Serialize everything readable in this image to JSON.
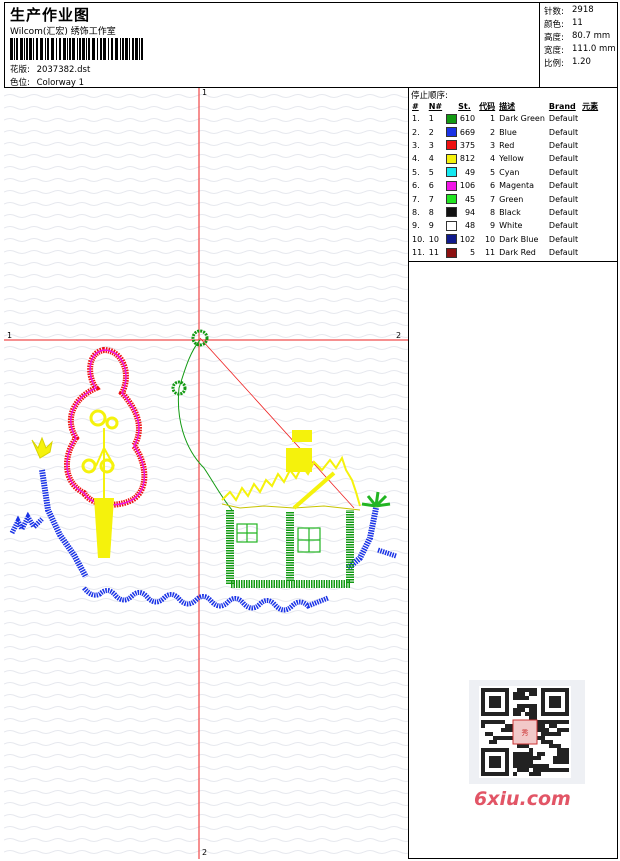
{
  "header": {
    "title": "生产作业图",
    "subtitle": "Wilcom(汇宏) 绣饰工作室",
    "design_label": "花版:",
    "design_value": "2037382.dst",
    "colorway_label": "色位:",
    "colorway_value": "Colorway 1"
  },
  "stats": [
    {
      "label": "针数:",
      "value": "2918"
    },
    {
      "label": "颜色:",
      "value": "11"
    },
    {
      "label": "高度:",
      "value": "80.7 mm"
    },
    {
      "label": "宽度:",
      "value": "111.0 mm"
    },
    {
      "label": "比例:",
      "value": "1.20"
    }
  ],
  "axes": {
    "top": "1",
    "bottom": "2",
    "left": "1",
    "right": "2"
  },
  "sequence": {
    "title": "停止顺序:",
    "columns": [
      "#",
      "N#",
      "St.",
      "代码",
      "描述",
      "Brand",
      "元素"
    ],
    "rows": [
      {
        "idx": "1.",
        "n": "1",
        "color": "#129a12",
        "st": "610",
        "code": "1",
        "desc": "Dark Green",
        "brand": "Default"
      },
      {
        "idx": "2.",
        "n": "2",
        "color": "#1a33e6",
        "st": "669",
        "code": "2",
        "desc": "Blue",
        "brand": "Default"
      },
      {
        "idx": "3.",
        "n": "3",
        "color": "#ee1111",
        "st": "375",
        "code": "3",
        "desc": "Red",
        "brand": "Default"
      },
      {
        "idx": "4.",
        "n": "4",
        "color": "#f5f20c",
        "st": "812",
        "code": "4",
        "desc": "Yellow",
        "brand": "Default"
      },
      {
        "idx": "5.",
        "n": "5",
        "color": "#14e8f0",
        "st": "49",
        "code": "5",
        "desc": "Cyan",
        "brand": "Default"
      },
      {
        "idx": "6.",
        "n": "6",
        "color": "#f014e6",
        "st": "106",
        "code": "6",
        "desc": "Magenta",
        "brand": "Default"
      },
      {
        "idx": "7.",
        "n": "7",
        "color": "#22e622",
        "st": "45",
        "code": "7",
        "desc": "Green",
        "brand": "Default"
      },
      {
        "idx": "8.",
        "n": "8",
        "color": "#111111",
        "st": "94",
        "code": "8",
        "desc": "Black",
        "brand": "Default"
      },
      {
        "idx": "9.",
        "n": "9",
        "color": "#ffffff",
        "st": "48",
        "code": "9",
        "desc": "White",
        "brand": "Default"
      },
      {
        "idx": "10.",
        "n": "10",
        "color": "#101a8c",
        "st": "102",
        "code": "10",
        "desc": "Dark Blue",
        "brand": "Default"
      },
      {
        "idx": "11.",
        "n": "11",
        "color": "#8c1010",
        "st": "5",
        "code": "11",
        "desc": "Dark Red",
        "brand": "Default"
      }
    ]
  },
  "watermark": "6xiu.com"
}
